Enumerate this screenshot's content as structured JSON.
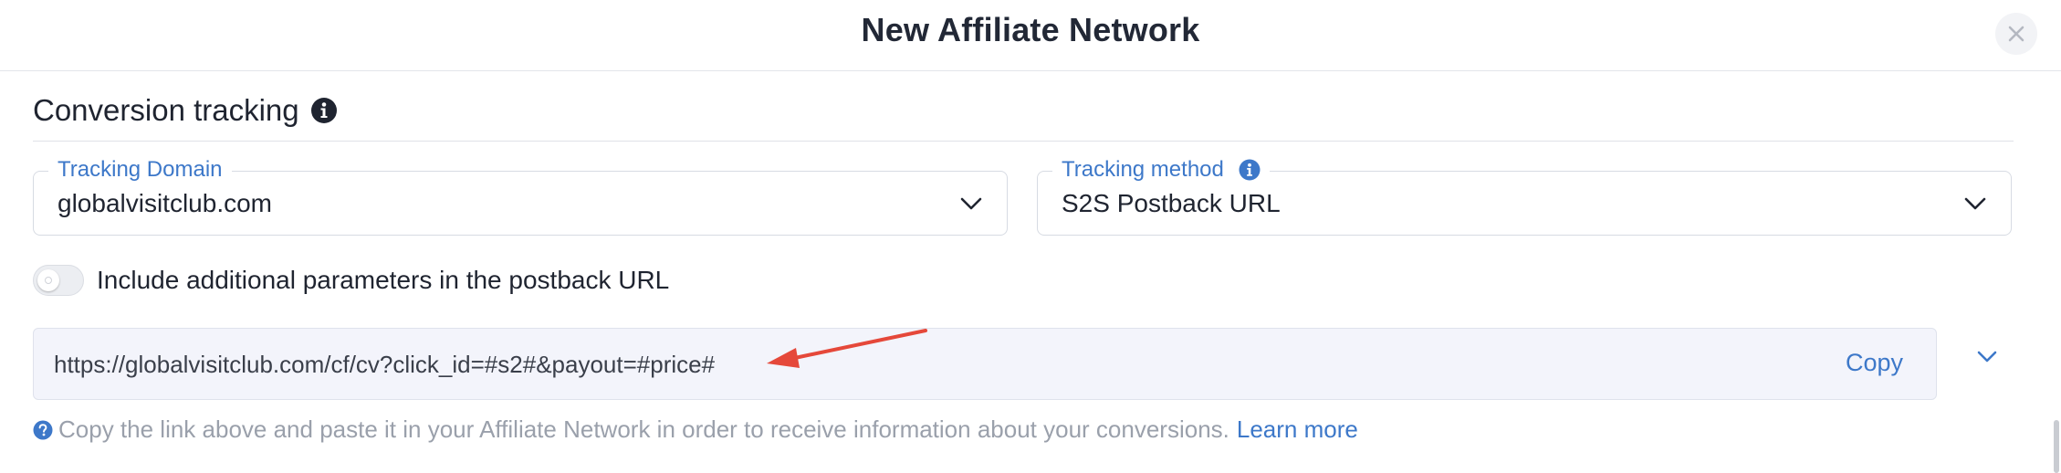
{
  "header": {
    "title": "New Affiliate Network",
    "close_icon": "close-icon"
  },
  "section": {
    "title": "Conversion tracking",
    "info_icon": "info-circle-icon"
  },
  "tracking_domain": {
    "label": "Tracking Domain",
    "value": "globalvisitclub.com",
    "icon": "chevron-down-icon"
  },
  "tracking_method": {
    "label": "Tracking method",
    "value": "S2S Postback URL",
    "info_icon": "info-circle-icon",
    "icon": "chevron-down-icon"
  },
  "toggle": {
    "label": "Include additional parameters in the postback URL",
    "checked": false
  },
  "postback": {
    "url": "https://globalvisitclub.com/cf/cv?click_id=#s2#&payout=#price#",
    "copy_label": "Copy",
    "expand_icon": "chevron-down-icon"
  },
  "hint": {
    "icon": "question-circle-icon",
    "text": "Copy the link above and paste it in your Affiliate Network in order to receive information about your conversions.",
    "link_label": "Learn more"
  },
  "colors": {
    "accent": "#3d78c9",
    "annotation_arrow": "#e5483a",
    "url_box_bg": "#f3f4fb",
    "hint_text": "#9aa0ab"
  }
}
